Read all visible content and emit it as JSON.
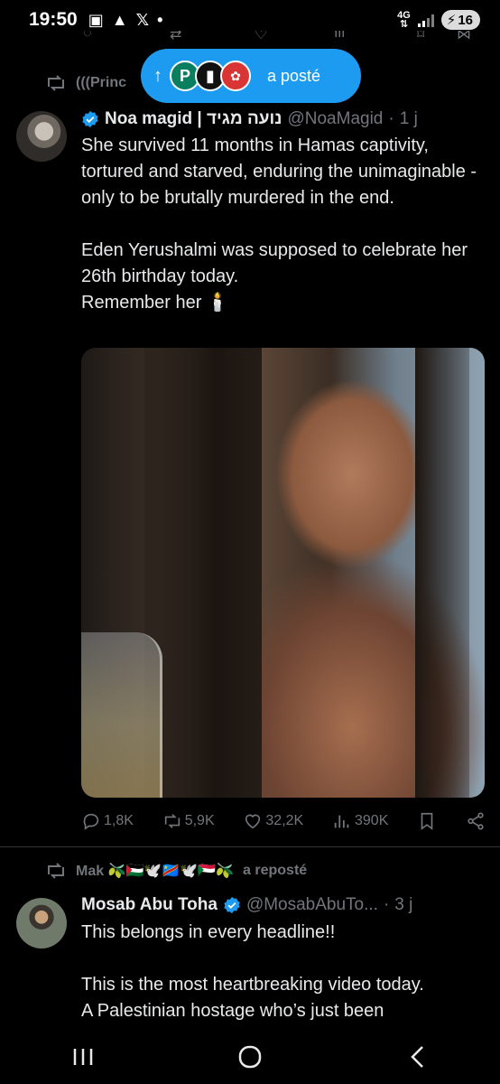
{
  "status_bar": {
    "time": "19:50",
    "network": "4G",
    "battery": "16"
  },
  "pill": {
    "label": "a posté"
  },
  "tweet1": {
    "repost_by": "(((Princ",
    "name": "Noa magid | נועה מגיד",
    "handle": "@NoaMagid",
    "age": "1 j",
    "text": "She survived 11 months in Hamas captivity, tortured and starved, enduring the unimaginable - only to be brutally murdered in the end.\n\nEden Yerushalmi was supposed to celebrate her 26th birthday today.\nRemember her 🕯️",
    "replies": "1,8K",
    "reposts": "5,9K",
    "likes": "32,2K",
    "views": "390K"
  },
  "tweet2": {
    "repost_by": "Mak 🫒🇵🇸🕊️🇨🇩🕊️🇸🇩🫒",
    "repost_suffix": "a reposté",
    "name": "Mosab Abu Toha",
    "handle": "@MosabAbuTo...",
    "age": "3 j",
    "text": "This belongs in every headline!!\n\nThis is the most heartbreaking video today.\nA Palestinian hostage who’s just been"
  },
  "colors": {
    "accent": "#1d9bf0",
    "background": "#000000",
    "muted": "#71767b",
    "text": "#e7e9ea"
  },
  "icons": [
    "reply-icon",
    "repost-icon",
    "like-icon",
    "views-icon",
    "bookmark-icon",
    "share-icon",
    "verified-icon",
    "recents-icon",
    "home-icon",
    "back-icon"
  ]
}
